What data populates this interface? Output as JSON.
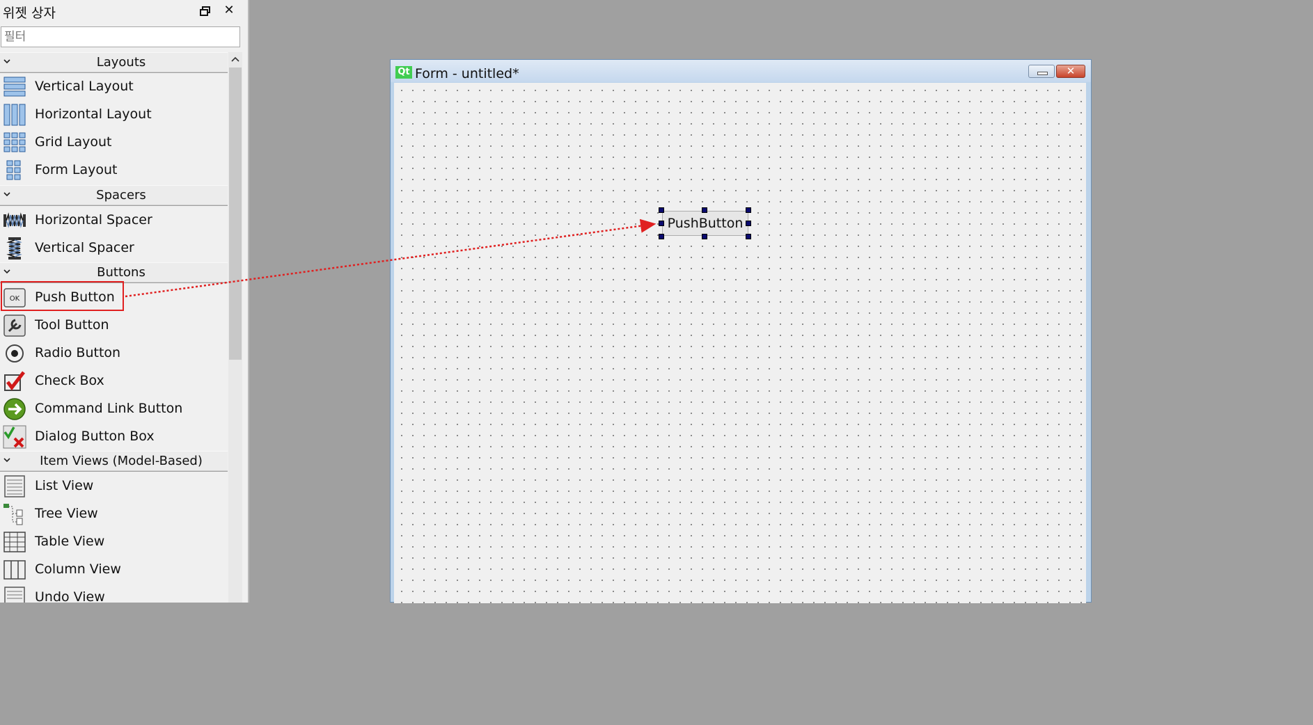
{
  "widget_box": {
    "title": "위젯 상자",
    "filter_placeholder": "필터",
    "categories": [
      {
        "label": "Layouts",
        "items": [
          {
            "label": "Vertical Layout",
            "icon": "vertical-layout-icon"
          },
          {
            "label": "Horizontal Layout",
            "icon": "horizontal-layout-icon"
          },
          {
            "label": "Grid Layout",
            "icon": "grid-layout-icon"
          },
          {
            "label": "Form Layout",
            "icon": "form-layout-icon"
          }
        ]
      },
      {
        "label": "Spacers",
        "items": [
          {
            "label": "Horizontal Spacer",
            "icon": "horizontal-spacer-icon"
          },
          {
            "label": "Vertical Spacer",
            "icon": "vertical-spacer-icon"
          }
        ]
      },
      {
        "label": "Buttons",
        "items": [
          {
            "label": "Push Button",
            "icon": "push-button-icon"
          },
          {
            "label": "Tool Button",
            "icon": "tool-button-icon"
          },
          {
            "label": "Radio Button",
            "icon": "radio-button-icon"
          },
          {
            "label": "Check Box",
            "icon": "check-box-icon"
          },
          {
            "label": "Command Link Button",
            "icon": "command-link-icon"
          },
          {
            "label": "Dialog Button Box",
            "icon": "dialog-button-box-icon"
          }
        ]
      },
      {
        "label": "Item Views (Model-Based)",
        "items": [
          {
            "label": "List View",
            "icon": "list-view-icon"
          },
          {
            "label": "Tree View",
            "icon": "tree-view-icon"
          },
          {
            "label": "Table View",
            "icon": "table-view-icon"
          },
          {
            "label": "Column View",
            "icon": "column-view-icon"
          },
          {
            "label": "Undo View",
            "icon": "undo-view-icon"
          }
        ]
      }
    ]
  },
  "form_window": {
    "qt_logo": "Qt",
    "title": "Form - untitled*",
    "close_glyph": "✕",
    "push_button_text": "PushButton"
  },
  "colors": {
    "highlight": "#e02020",
    "arrow": "#e02020",
    "handle": "#0a0a6e"
  }
}
